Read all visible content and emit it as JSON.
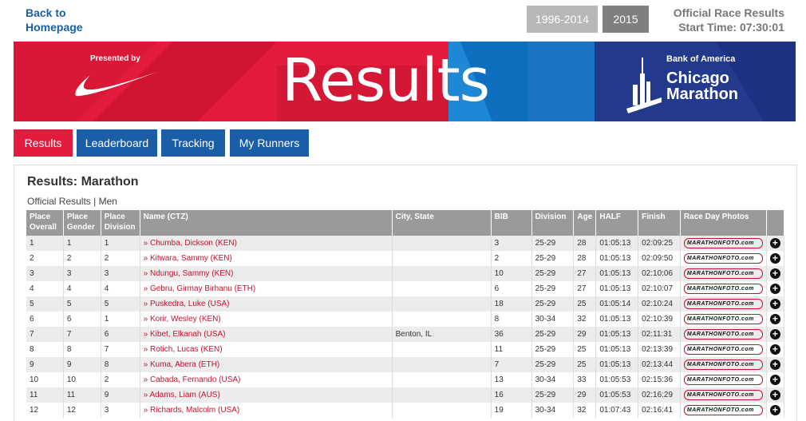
{
  "nav": {
    "back_label": "Back to\nHomepage",
    "year_range": "1996-2014",
    "year_current": "2015",
    "official_title": "Official Race Results",
    "start_time": "Start Time: 07:30:01"
  },
  "banner": {
    "presented_by": "Presented by",
    "title": "Results",
    "brand_line": "Bank of America",
    "event_line1": "Chicago",
    "event_line2": "Marathon"
  },
  "tabs": [
    {
      "label": "Results"
    },
    {
      "label": "Leaderboard"
    },
    {
      "label": "Tracking"
    },
    {
      "label": "My Runners"
    }
  ],
  "panel": {
    "title": "Results: Marathon",
    "subtitle": "Official Results | Men"
  },
  "table": {
    "headers": [
      "Place Overall",
      "Place Gender",
      "Place Division",
      "Name (CTZ)",
      "City, State",
      "BIB",
      "Division",
      "Age",
      "HALF",
      "Finish",
      "Race Day Photos",
      ""
    ],
    "photo_label": "MARATHONFOTO.com",
    "rows": [
      {
        "overall": "1",
        "gender": "1",
        "division_place": "1",
        "name": "» Chumba, Dickson (KEN)",
        "city": "",
        "bib": "3",
        "division": "25-29",
        "age": "28",
        "half": "01:05:13",
        "finish": "02:09:25"
      },
      {
        "overall": "2",
        "gender": "2",
        "division_place": "2",
        "name": "» Kitwara, Sammy (KEN)",
        "city": "",
        "bib": "2",
        "division": "25-29",
        "age": "28",
        "half": "01:05:13",
        "finish": "02:09:50"
      },
      {
        "overall": "3",
        "gender": "3",
        "division_place": "3",
        "name": "» Ndungu, Sammy (KEN)",
        "city": "",
        "bib": "10",
        "division": "25-29",
        "age": "27",
        "half": "01:05:13",
        "finish": "02:10:06"
      },
      {
        "overall": "4",
        "gender": "4",
        "division_place": "4",
        "name": "» Gebru, Girmay Birhanu (ETH)",
        "city": "",
        "bib": "6",
        "division": "25-29",
        "age": "27",
        "half": "01:05:13",
        "finish": "02:10:07"
      },
      {
        "overall": "5",
        "gender": "5",
        "division_place": "5",
        "name": "» Puskedra, Luke (USA)",
        "city": "",
        "bib": "18",
        "division": "25-29",
        "age": "25",
        "half": "01:05:14",
        "finish": "02:10:24"
      },
      {
        "overall": "6",
        "gender": "6",
        "division_place": "1",
        "name": "» Korir, Wesley (KEN)",
        "city": "",
        "bib": "8",
        "division": "30-34",
        "age": "32",
        "half": "01:05:13",
        "finish": "02:10:39"
      },
      {
        "overall": "7",
        "gender": "7",
        "division_place": "6",
        "name": "» Kibet, Elkanah (USA)",
        "city": "Benton, IL",
        "bib": "36",
        "division": "25-29",
        "age": "29",
        "half": "01:05:13",
        "finish": "02:11:31"
      },
      {
        "overall": "8",
        "gender": "8",
        "division_place": "7",
        "name": "» Rotich, Lucas (KEN)",
        "city": "",
        "bib": "11",
        "division": "25-29",
        "age": "25",
        "half": "01:05:13",
        "finish": "02:13:39"
      },
      {
        "overall": "9",
        "gender": "9",
        "division_place": "8",
        "name": "» Kuma, Abera (ETH)",
        "city": "",
        "bib": "7",
        "division": "25-29",
        "age": "25",
        "half": "01:05:13",
        "finish": "02:13:44"
      },
      {
        "overall": "10",
        "gender": "10",
        "division_place": "2",
        "name": "» Cabada, Fernando (USA)",
        "city": "",
        "bib": "13",
        "division": "30-34",
        "age": "33",
        "half": "01:05:53",
        "finish": "02:15:36"
      },
      {
        "overall": "11",
        "gender": "11",
        "division_place": "9",
        "name": "» Adams, Liam (AUS)",
        "city": "",
        "bib": "16",
        "division": "25-29",
        "age": "29",
        "half": "01:05:53",
        "finish": "02:16:29"
      },
      {
        "overall": "12",
        "gender": "12",
        "division_place": "3",
        "name": "» Richards, Malcolm (USA)",
        "city": "",
        "bib": "19",
        "division": "30-34",
        "age": "32",
        "half": "01:07:43",
        "finish": "02:16:41"
      }
    ]
  },
  "colors": {
    "brand_red": "#e31b3c",
    "brand_blue": "#1a5ea8",
    "banner_navy": "#233a8c",
    "link_red": "#c8102e"
  }
}
